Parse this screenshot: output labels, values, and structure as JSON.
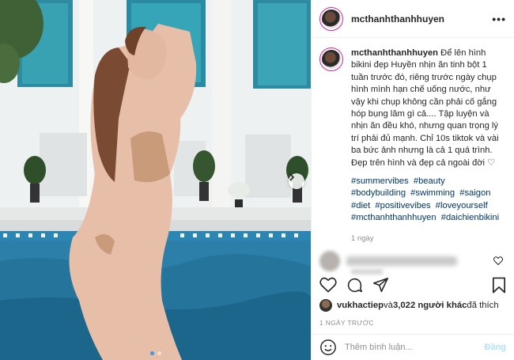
{
  "post": {
    "username": "mcthanhthanhhuyen",
    "more_label": "•••",
    "caption_text": "Để lên hình bikini đẹp Huyền nhịn ăn tinh bột 1 tuần trước đó, riêng trước ngày chụp hình mình hạn chế uống nước, như vậy khi chụp không cần phải cố gắng hóp bụng lâm gì cả.... Tập luyện và nhịn ăn đều khó, nhưng quan trọng lý trí phải đủ mạnh. Chỉ 10s tiktok và vài ba bức ảnh nhưng là cả 1 quá trình. Đẹp trên hình và đẹp cả ngoài đời ♡",
    "hashtags": [
      "#summervibes",
      "#beauty",
      "#bodybuilding",
      "#swimming",
      "#saigon",
      "#diet",
      "#positivevibes",
      "#loveyourself",
      "#mcthanhthanhhuyen",
      "#daichienbikini"
    ],
    "caption_time": "1 ngày"
  },
  "likes": {
    "user": "vukhactiep",
    "middle": " và ",
    "count": "3,022 người khác",
    "suffix": " đã thích"
  },
  "date": "1 NGÀY TRƯỚC",
  "comment": {
    "placeholder": "Thêm bình luận...",
    "post_label": "Đăng"
  },
  "carousel": {
    "total": 2,
    "active": 1
  },
  "colors": {
    "accent": "#3897f0",
    "hashtag": "#003569",
    "muted": "#8e8e8e",
    "post_disabled": "#b2dffc"
  }
}
